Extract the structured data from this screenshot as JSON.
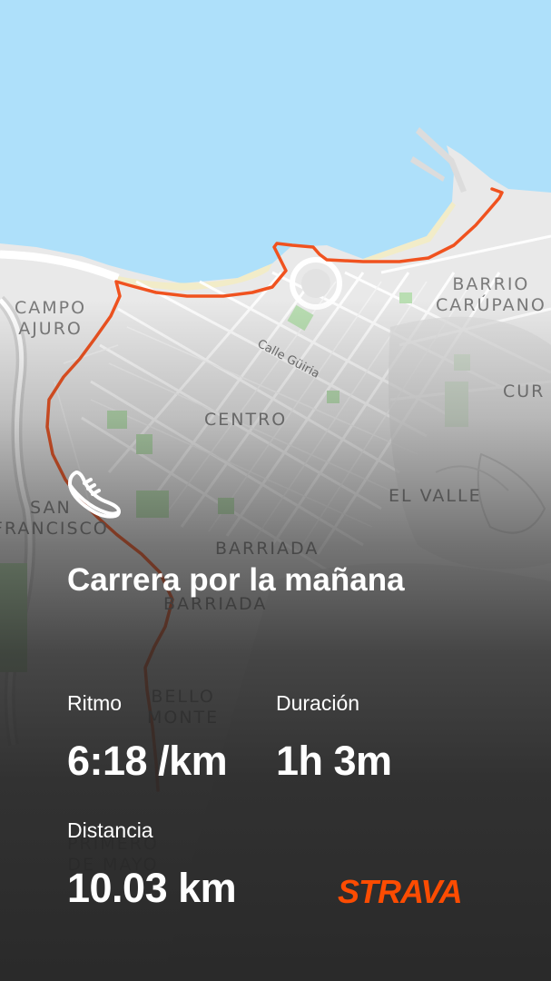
{
  "activity": {
    "title": "Carrera por la mañana",
    "icon": "running-shoe-icon"
  },
  "stats": {
    "pace": {
      "label": "Ritmo",
      "value": "6:18 /km"
    },
    "duration": {
      "label": "Duración",
      "value": "1h 3m"
    },
    "distance": {
      "label": "Distancia",
      "value": "10.03 km"
    }
  },
  "brand": {
    "name": "STRAVA",
    "color": "#fc4c02"
  },
  "map": {
    "labels": {
      "campo_ajuro": "CAMPO\nAJURO",
      "barrio_carupano": "BARRIO\nCARÚPANO",
      "centro": "CENTRO",
      "el_valle": "EL VALLE",
      "san_francisco": "SAN\nFRANCISCO",
      "barriada_1": "BARRIADA",
      "barriada_2": "BARRIADA",
      "bello_monte": "BELLO\nMONTE",
      "primero_de_mayo": "PRIMERO\nDE MAYO",
      "cur": "CUR",
      "calle_guiria": "Calle Güiria"
    },
    "colors": {
      "sea": "#aee0fa",
      "land": "#ececec",
      "route": "#f0521f",
      "park": "#b9deb2"
    }
  }
}
